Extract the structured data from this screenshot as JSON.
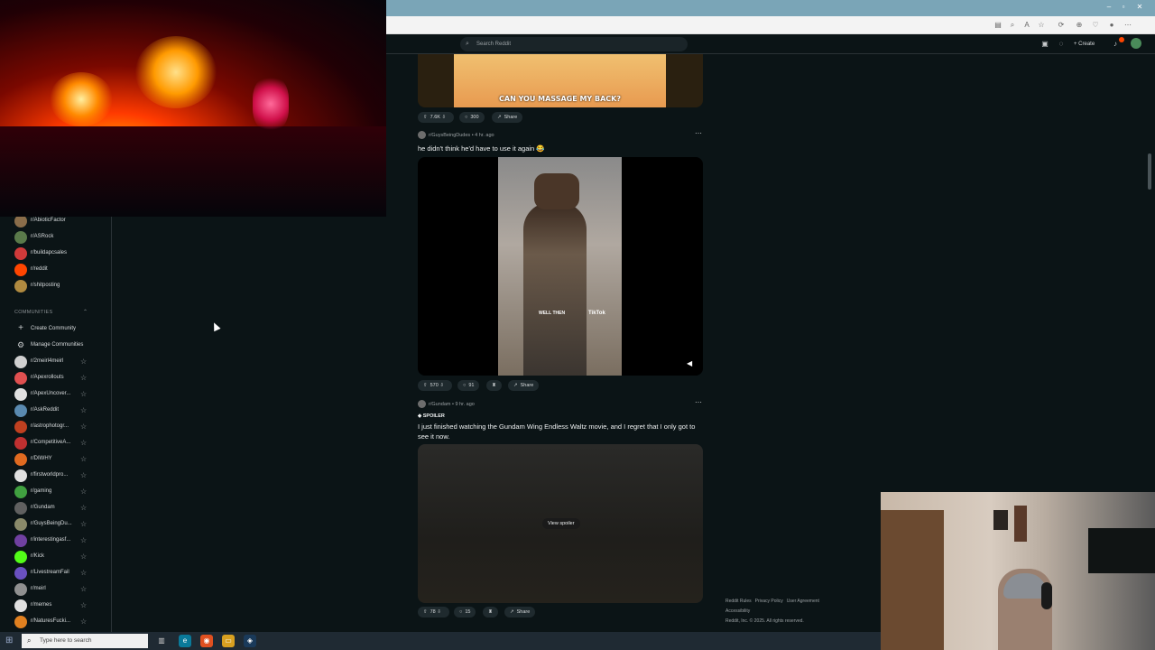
{
  "search": {
    "placeholder": "Search Reddit"
  },
  "header": {
    "create_label": "Create"
  },
  "sidebar": {
    "recent": [
      {
        "label": "r/AbioticFactor",
        "color": "#8a6d4a"
      },
      {
        "label": "r/ASRock",
        "color": "#5a7a4a"
      },
      {
        "label": "r/buildapcsales",
        "color": "#d03a3a"
      },
      {
        "label": "r/reddit",
        "color": "#ff4500"
      },
      {
        "label": "r/shitposting",
        "color": "#b08a40"
      }
    ],
    "communities_header": "COMMUNITIES",
    "create_community": "Create Community",
    "manage_communities": "Manage Communities",
    "communities": [
      {
        "label": "r/2meirl4meirl",
        "color": "#d0d0d0"
      },
      {
        "label": "r/Apexrollouts",
        "color": "#e05050"
      },
      {
        "label": "r/ApexUncover...",
        "color": "#e0e0e0"
      },
      {
        "label": "r/AskReddit",
        "color": "#5a8ab0"
      },
      {
        "label": "r/astrophotogr...",
        "color": "#c04020"
      },
      {
        "label": "r/CompetitiveA...",
        "color": "#c03030"
      },
      {
        "label": "r/DIWHY",
        "color": "#e06a20"
      },
      {
        "label": "r/firstworldpro...",
        "color": "#e0e0e0"
      },
      {
        "label": "r/gaming",
        "color": "#40a040"
      },
      {
        "label": "r/Gundam",
        "color": "#606060"
      },
      {
        "label": "r/GuysBeingDu...",
        "color": "#8a8a6a"
      },
      {
        "label": "r/interestingasf...",
        "color": "#7040a0"
      },
      {
        "label": "r/Kick",
        "color": "#53fc18"
      },
      {
        "label": "r/LivestreamFail",
        "color": "#6a50c0"
      },
      {
        "label": "r/meirl",
        "color": "#909090"
      },
      {
        "label": "r/memes",
        "color": "#e0e0e0"
      },
      {
        "label": "r/NaturesFucki...",
        "color": "#e08020"
      }
    ]
  },
  "posts": {
    "p1": {
      "caption": "CAN YOU MASSAGE MY BACK?",
      "votes": "7.6K",
      "comments": "300",
      "share": "Share"
    },
    "p2": {
      "subreddit": "r/GuysBeingDudes",
      "time": "• 4 hr. ago",
      "title": "he didn't think he'd have to use it again 😂",
      "overlay_text": "WELL THEN",
      "watermark": "TikTok",
      "votes": "570",
      "comments": "91",
      "share": "Share"
    },
    "p3": {
      "subreddit": "r/Gundam",
      "time": "• 9 hr. ago",
      "spoiler": "SPOILER",
      "title": "I just finished watching the Gundam Wing Endless Waltz movie, and I regret that I only got to see it now.",
      "view_spoiler": "View spoiler",
      "votes": "78",
      "comments": "15",
      "share": "Share"
    }
  },
  "footer": {
    "rules": "Reddit Rules",
    "privacy": "Privacy Policy",
    "agreement": "User Agreement",
    "accessibility": "Accessibility",
    "copyright": "Reddit, Inc. © 2025. All rights reserved."
  },
  "taskbar": {
    "search_placeholder": "Type here to search"
  },
  "icons": {
    "search": "search-icon",
    "upvote": "upvote-icon",
    "downvote": "downvote-icon",
    "comment": "comment-icon",
    "share": "share-icon",
    "star": "star-icon"
  }
}
